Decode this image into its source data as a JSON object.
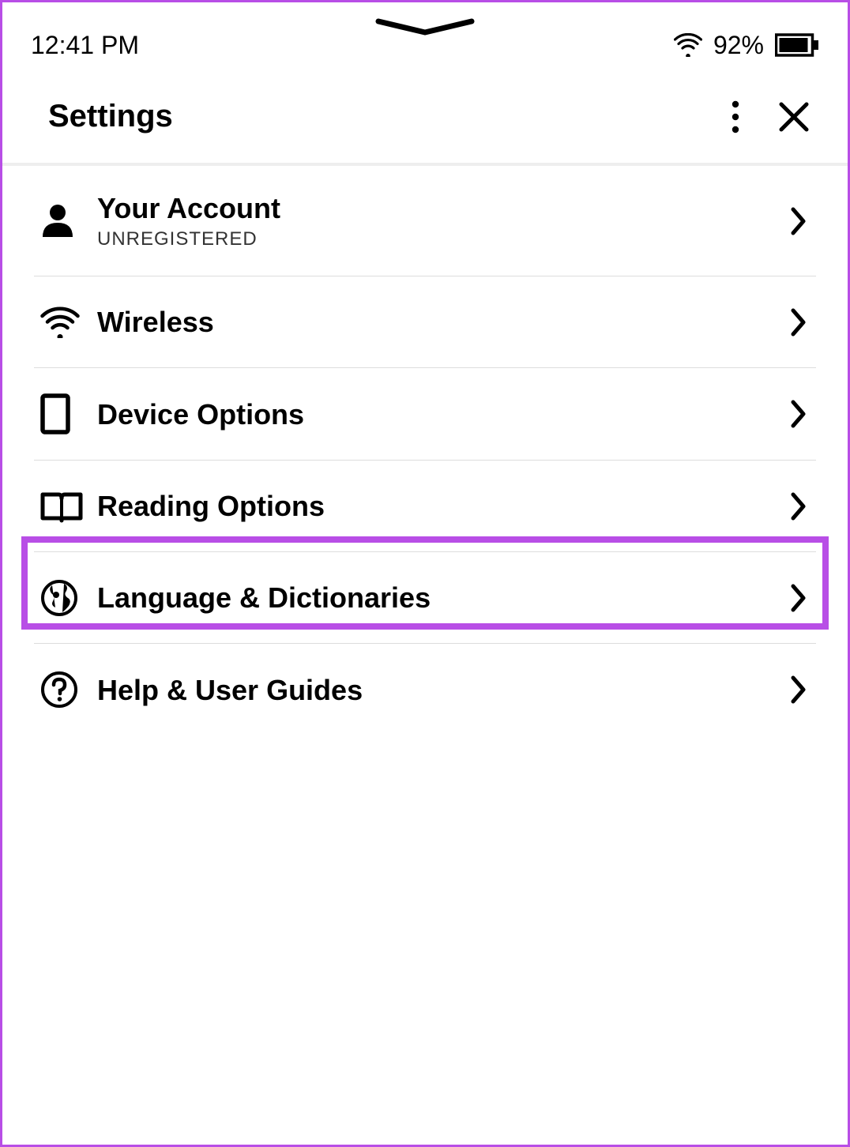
{
  "status": {
    "time": "12:41 PM",
    "battery_percent": "92%"
  },
  "header": {
    "title": "Settings"
  },
  "items": [
    {
      "title": "Your Account",
      "subtitle": "UNREGISTERED"
    },
    {
      "title": "Wireless"
    },
    {
      "title": "Device Options"
    },
    {
      "title": "Reading Options"
    },
    {
      "title": "Language & Dictionaries"
    },
    {
      "title": "Help & User Guides"
    }
  ],
  "highlighted_index": 4
}
